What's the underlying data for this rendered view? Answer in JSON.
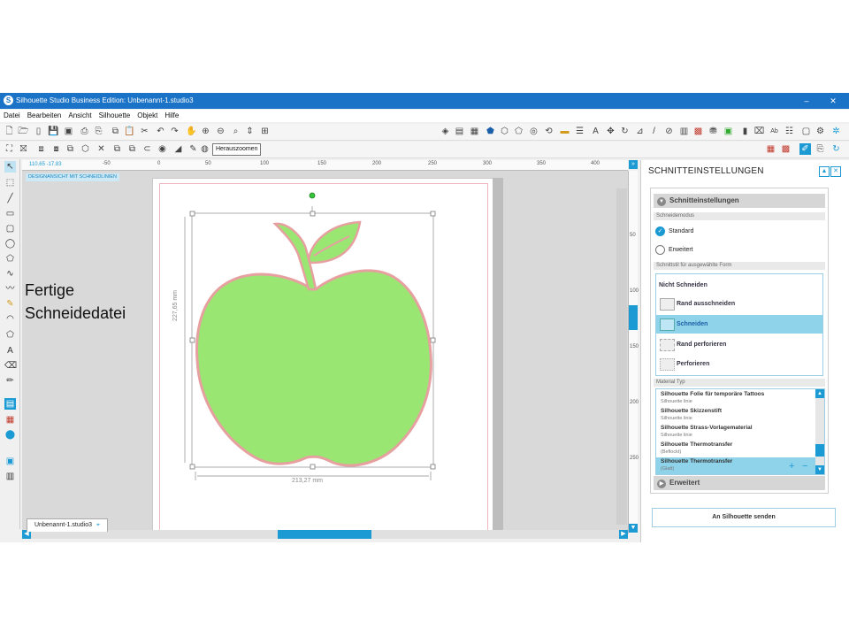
{
  "window": {
    "title": "Silhouette Studio Business Edition: Unbenannt-1.studio3",
    "controls": {
      "minimize": "–",
      "maximize": "☐",
      "close": "✕"
    }
  },
  "menu": [
    "Datei",
    "Bearbeiten",
    "Ansicht",
    "Silhouette",
    "Objekt",
    "Hilfe"
  ],
  "tooltip": "Herauszoomen",
  "canvas": {
    "mode_label": "DESIGNANSICHT MIT SCHNEIDLINIEN",
    "coords": "110.65 -17.83",
    "ruler_ticks": [
      "-50",
      "0",
      "50",
      "100",
      "150",
      "200",
      "250",
      "300",
      "350",
      "400"
    ],
    "vruler_ticks": [
      "50",
      "100",
      "150",
      "200",
      "250"
    ],
    "height_dim": "227,65 mm",
    "width_dim": "213,27 mm",
    "fill_color": "#99e673",
    "stroke_color": "#e7a0a0"
  },
  "document_tab": {
    "label": "Unbenannt-1.studio3",
    "pin": "⌖"
  },
  "caption": {
    "line1": "Fertige",
    "line2": "Schneidedatei"
  },
  "panel": {
    "title": "SCHNITTEINSTELLUNGEN",
    "section_title": "Schnitteinstellungen",
    "mode_label": "Schneidemodus",
    "modes": [
      {
        "label": "Standard",
        "selected": true
      },
      {
        "label": "Erweitert",
        "selected": false
      }
    ],
    "cut_style_label": "Schnittstil für ausgewählte Form",
    "cut_options": [
      {
        "label": "Nicht Schneiden",
        "selected": false
      },
      {
        "label": "Rand ausschneiden",
        "selected": false
      },
      {
        "label": "Schneiden",
        "selected": true
      },
      {
        "label": "Rand perforieren",
        "selected": false
      },
      {
        "label": "Perforieren",
        "selected": false
      }
    ],
    "material_label": "Material Typ",
    "materials": [
      {
        "name": "Silhouette Folie für temporäre Tattoos",
        "sub": "Silhouette linie"
      },
      {
        "name": "Silhouette Skizzenstift",
        "sub": "Silhouette linie"
      },
      {
        "name": "Silhouette Strass-Vorlagematerial",
        "sub": "Silhouette linie"
      },
      {
        "name": "Silhouette Thermotransfer",
        "sub": "(Beflockt)"
      },
      {
        "name": "Silhouette Thermotransfer",
        "sub": "(Glatt)"
      }
    ],
    "material_add": "+",
    "material_remove": "−",
    "advanced": "Erweitert",
    "send_button": "An Silhouette senden",
    "accent": "#1b9ad4"
  }
}
